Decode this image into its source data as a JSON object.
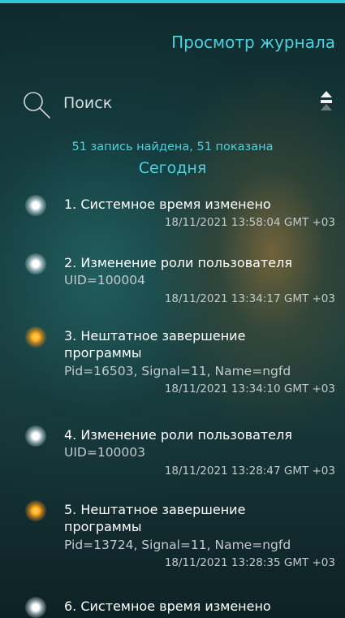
{
  "header": {
    "title": "Просмотр журнала"
  },
  "search": {
    "placeholder": "Поиск"
  },
  "summary": {
    "found_text": "51 запись найдена, 51 показана"
  },
  "date_group": {
    "label": "Сегодня"
  },
  "entries": [
    {
      "title": "1. Системное время изменено",
      "detail": "",
      "timestamp": "18/11/2021 13:58:04 GMT +03",
      "severity": "info",
      "indicator_color": "#ffffff"
    },
    {
      "title": "2. Изменение роли пользователя",
      "detail": "UID=100004",
      "timestamp": "18/11/2021 13:34:17 GMT +03",
      "severity": "info",
      "indicator_color": "#ffffff"
    },
    {
      "title": "3. Нештатное завершение программы",
      "detail": "Pid=16503, Signal=11, Name=ngfd",
      "timestamp": "18/11/2021 13:34:10 GMT +03",
      "severity": "warning",
      "indicator_color": "#ffb21e"
    },
    {
      "title": "4. Изменение роли пользователя",
      "detail": "UID=100003",
      "timestamp": "18/11/2021 13:28:47 GMT +03",
      "severity": "info",
      "indicator_color": "#ffffff"
    },
    {
      "title": "5. Нештатное завершение программы",
      "detail": "Pid=13724, Signal=11, Name=ngfd",
      "timestamp": "18/11/2021 13:28:35 GMT +03",
      "severity": "warning",
      "indicator_color": "#ffb21e"
    },
    {
      "title": "6. Системное время изменено",
      "detail": "",
      "timestamp": "",
      "severity": "info",
      "indicator_color": "#ffffff"
    }
  ],
  "colors": {
    "accent": "#4fd0dd",
    "top_bar": "#2ec8d6",
    "warning": "#ffb21e"
  },
  "icons": {
    "search": "search-icon",
    "collapse": "collapse-all-icon"
  }
}
